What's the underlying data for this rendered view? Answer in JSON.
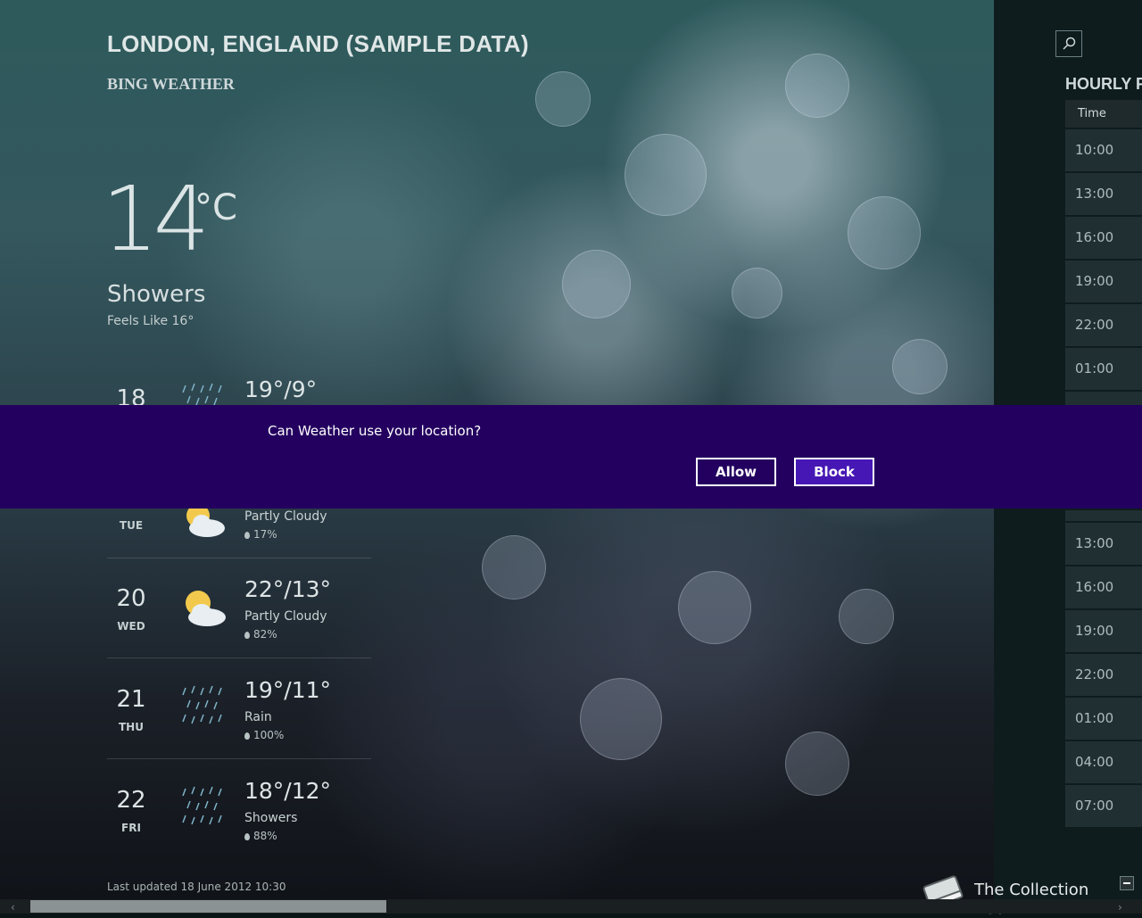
{
  "header": {
    "location": "LONDON, ENGLAND (SAMPLE DATA)",
    "provider": "BING WEATHER"
  },
  "current": {
    "temperature": "14",
    "unit": "°C",
    "condition": "Showers",
    "feels_like": "Feels Like 16°"
  },
  "forecast": [
    {
      "day_num": "18",
      "day_name": "",
      "temp": "19°/9°",
      "condition": "",
      "precip": "",
      "icon": "rain-icon"
    },
    {
      "day_num": "",
      "day_name": "TUE",
      "temp": "",
      "condition": "Partly Cloudy",
      "precip": "17%",
      "icon": "partly-cloudy-icon"
    },
    {
      "day_num": "20",
      "day_name": "WED",
      "temp": "22°/13°",
      "condition": "Partly Cloudy",
      "precip": "82%",
      "icon": "partly-cloudy-icon"
    },
    {
      "day_num": "21",
      "day_name": "THU",
      "temp": "19°/11°",
      "condition": "Rain",
      "precip": "100%",
      "icon": "rain-icon"
    },
    {
      "day_num": "22",
      "day_name": "FRI",
      "temp": "18°/12°",
      "condition": "Showers",
      "precip": "88%",
      "icon": "rain-icon"
    }
  ],
  "last_updated": "Last updated 18 June 2012 10:30",
  "hourly": {
    "title": "HOURLY FORECAST",
    "column_time": "Time",
    "times_top": [
      "10:00",
      "13:00",
      "16:00",
      "19:00",
      "22:00",
      "01:00"
    ],
    "times_bottom": [
      "13:00",
      "16:00",
      "19:00",
      "22:00",
      "01:00",
      "04:00",
      "07:00"
    ]
  },
  "consent": {
    "question": "Can Weather use your location?",
    "allow": "Allow",
    "block": "Block"
  },
  "watermark": "The Collection Book",
  "colors": {
    "dialog_bg": "#23005f",
    "block_button": "#4617b4"
  }
}
